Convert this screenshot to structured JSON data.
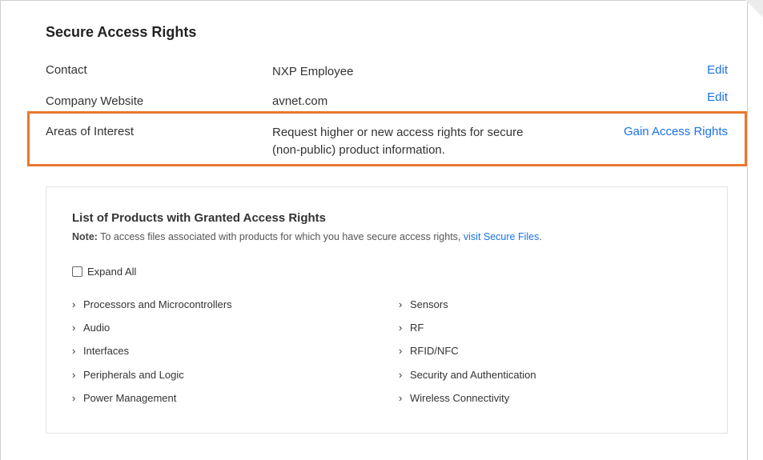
{
  "section": {
    "title": "Secure Access Rights",
    "rows": [
      {
        "label": "Contact",
        "value": "NXP Employee",
        "action": "Edit"
      },
      {
        "label": "Company Website",
        "value": "avnet.com",
        "action": "Edit"
      },
      {
        "label": "Areas of Interest",
        "value_line1": "Request higher or new access rights for secure",
        "value_line2": "(non-public) product information.",
        "action": "Gain Access Rights"
      }
    ]
  },
  "products_panel": {
    "title": "List of Products with Granted Access Rights",
    "note_label": "Note:",
    "note_text": " To access files associated with products for which you have secure access rights, ",
    "note_link": "visit Secure Files",
    "note_end": ".",
    "expand_all_label": "Expand All",
    "expand_all_checked": false,
    "left_items": [
      "Processors and Microcontrollers",
      "Audio",
      "Interfaces",
      "Peripherals and Logic",
      "Power Management"
    ],
    "right_items": [
      "Sensors",
      "RF",
      "RFID/NFC",
      "Security and Authentication",
      "Wireless Connectivity"
    ],
    "chevron_icon": "chevron-right-icon"
  },
  "colors": {
    "link": "#1a73e8",
    "highlight_border": "#e8772e"
  }
}
